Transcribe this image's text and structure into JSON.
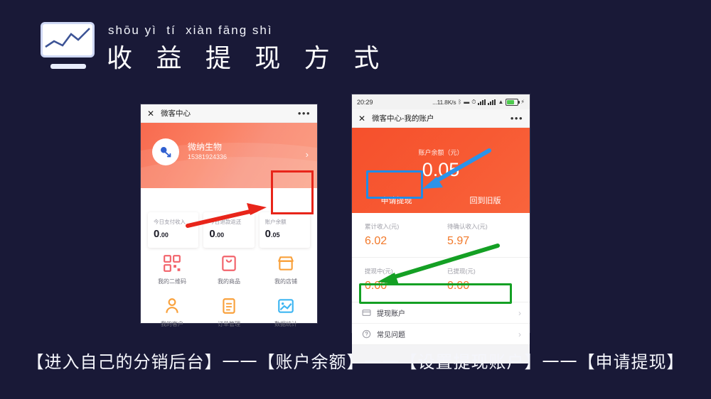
{
  "background_color": "#191937",
  "header": {
    "logo_icon": "line-chart-monitor-icon",
    "pinyin": "shōu yì  tí  xiàn fāng shì",
    "title": "收 益 提 现 方 式"
  },
  "phone_left": {
    "navbar": {
      "close_icon": "close-icon",
      "title": "微客中心",
      "more_icon": "more-dots-icon"
    },
    "profile": {
      "avatar_icon": "user-avatar-icon",
      "name": "微纳生物",
      "phone": "15381924336",
      "chevron_icon": "chevron-right-icon"
    },
    "stats": [
      {
        "label": "今日支付收入",
        "int": "0",
        "dec": ".00"
      },
      {
        "label": "今日退款返还",
        "int": "0",
        "dec": ".00"
      },
      {
        "label": "账户余额",
        "int": "0",
        "dec": ".05"
      }
    ],
    "menu": [
      {
        "label": "我的二维码",
        "icon": "qrcode-icon",
        "color": "#f2636b"
      },
      {
        "label": "我的商品",
        "icon": "shopping-bag-icon",
        "color": "#f2636b"
      },
      {
        "label": "我的店铺",
        "icon": "storefront-icon",
        "color": "#f9a13c"
      },
      {
        "label": "我的客户",
        "icon": "customer-person-icon",
        "color": "#f9a13c"
      },
      {
        "label": "订单管理",
        "icon": "clipboard-order-icon",
        "color": "#f9a13c"
      },
      {
        "label": "数据统计",
        "icon": "data-chart-icon",
        "color": "#3fb6f2"
      }
    ]
  },
  "phone_right": {
    "statusbar": {
      "time": "20:29",
      "network_speed": "...11.8K/s",
      "bluetooth_icon": "bluetooth-icon",
      "vibrate_icon": "vibrate-icon",
      "alarm_icon": "alarm-clock-icon",
      "signal_icon": "signal-bars-icon",
      "signal2_icon": "signal-bars-icon",
      "wifi_icon": "wifi-icon",
      "battery_icon": "battery-charging-icon",
      "charging_icon": "lightning-bolt-icon"
    },
    "navbar": {
      "close_icon": "close-icon",
      "title": "微客中心-我的账户",
      "more_icon": "more-dots-icon"
    },
    "balance": {
      "label": "账户余额（元）",
      "value": "0.05"
    },
    "hero_buttons": [
      {
        "label": "申请提现"
      },
      {
        "label": "回到旧版"
      }
    ],
    "money": [
      {
        "label": "累计收入(元)",
        "value": "6.02"
      },
      {
        "label": "待确认收入(元)",
        "value": "5.97"
      },
      {
        "label": "提现中(元)",
        "value": "0.00"
      },
      {
        "label": "已提现(元)",
        "value": "0.00"
      }
    ],
    "list_rows": [
      {
        "label": "提现账户",
        "icon": "bank-card-icon",
        "chevron": "chevron-right-icon"
      },
      {
        "label": "常见问题",
        "icon": "question-circle-icon",
        "chevron": "chevron-right-icon"
      }
    ]
  },
  "annotations": {
    "red_box_target": "账户余额",
    "blue_box_target": "申请提现",
    "green_box_target": "提现账户",
    "red_arrow": "red-arrow-icon",
    "blue_arrow": "blue-arrow-icon",
    "green_arrow": "green-arrow-icon"
  },
  "caption": "【进入自己的分销后台】一一【账户余额】一一【设置提现账户】一一【申请提现】"
}
